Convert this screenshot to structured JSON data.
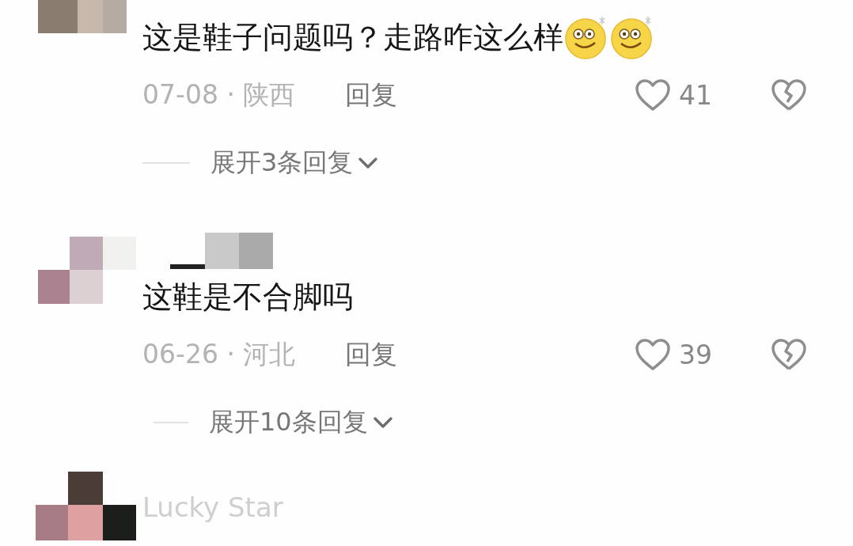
{
  "comments": [
    {
      "avatar": {
        "kind": "picture"
      },
      "text": "这是鞋子问题吗？走路咋这么样",
      "emoji": [
        {
          "kind": "dizzy-smile"
        },
        {
          "kind": "dizzy-smile"
        }
      ],
      "meta": "07-08 · 陕西",
      "reply": "回复",
      "likes": "41",
      "liked": false,
      "expand": "展开3条回复"
    },
    {
      "avatar": {
        "kind": "picture"
      },
      "username": {
        "censored": true
      },
      "text": "这鞋是不合脚吗",
      "meta": "06-26 · 河北",
      "reply": "回复",
      "likes": "39",
      "liked": false,
      "expand": "展开10条回复"
    },
    {
      "avatar": {
        "kind": "picture"
      },
      "username": {
        "censored": false,
        "text": "Lucky Star"
      }
    }
  ]
}
